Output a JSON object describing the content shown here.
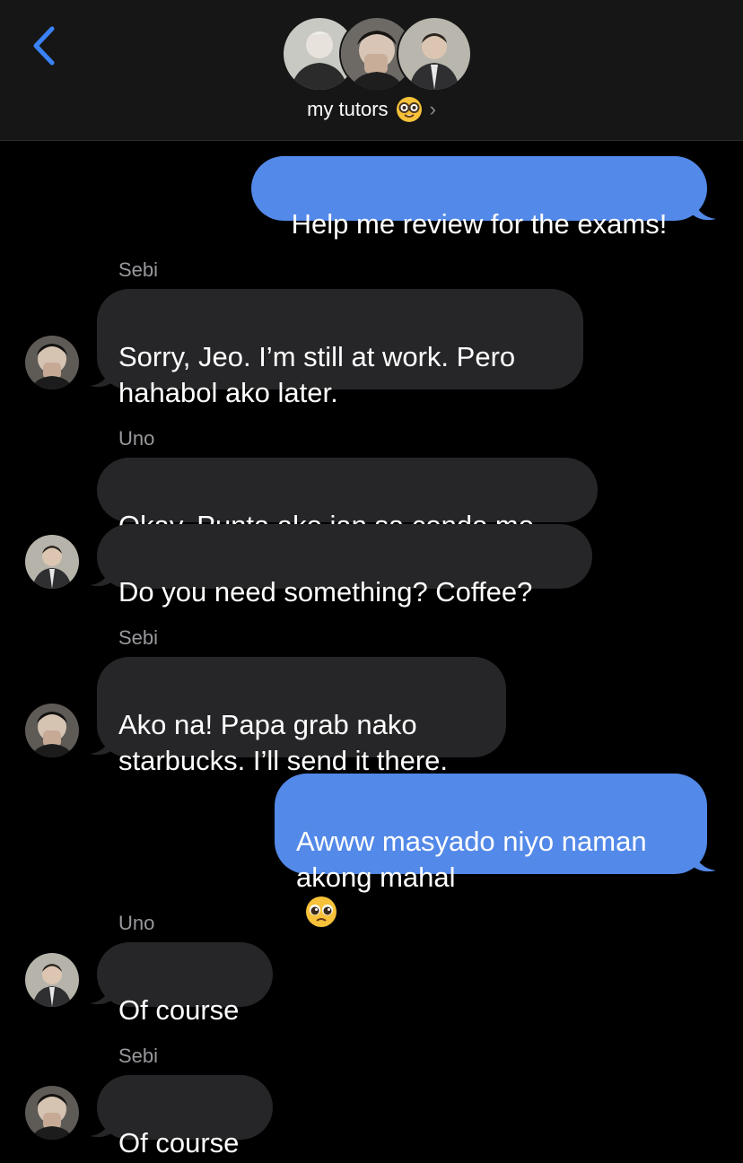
{
  "header": {
    "title": "my tutors",
    "title_emoji": "nerd-face-emoji",
    "chevron": "›"
  },
  "colors": {
    "header_bg": "#161616",
    "incoming_bubble": "#262628",
    "outgoing_bubble": "#5389e8",
    "sender_label": "#98989d",
    "accent": "#3a82f7"
  },
  "messages": [
    {
      "from": "me",
      "text": "Help me review for the exams!"
    },
    {
      "from": "Sebi",
      "sender_label": "Sebi",
      "text": "Sorry, Jeo. I’m still at work. Pero\nhahabol ako later."
    },
    {
      "from": "Uno",
      "sender_label": "Uno",
      "text": "Okay. Punta ako jan sa condo mo."
    },
    {
      "from": "Uno",
      "text": "Do you need something? Coffee?"
    },
    {
      "from": "Sebi",
      "sender_label": "Sebi",
      "text": "Ako na! Papa grab nako\nstarbucks. I’ll send it there."
    },
    {
      "from": "me",
      "text": "Awww masyado niyo naman\nakong mahal",
      "emoji": "pleading-face-emoji"
    },
    {
      "from": "Uno",
      "sender_label": "Uno",
      "text": "Of course"
    },
    {
      "from": "Sebi",
      "sender_label": "Sebi",
      "text": "Of course"
    }
  ]
}
